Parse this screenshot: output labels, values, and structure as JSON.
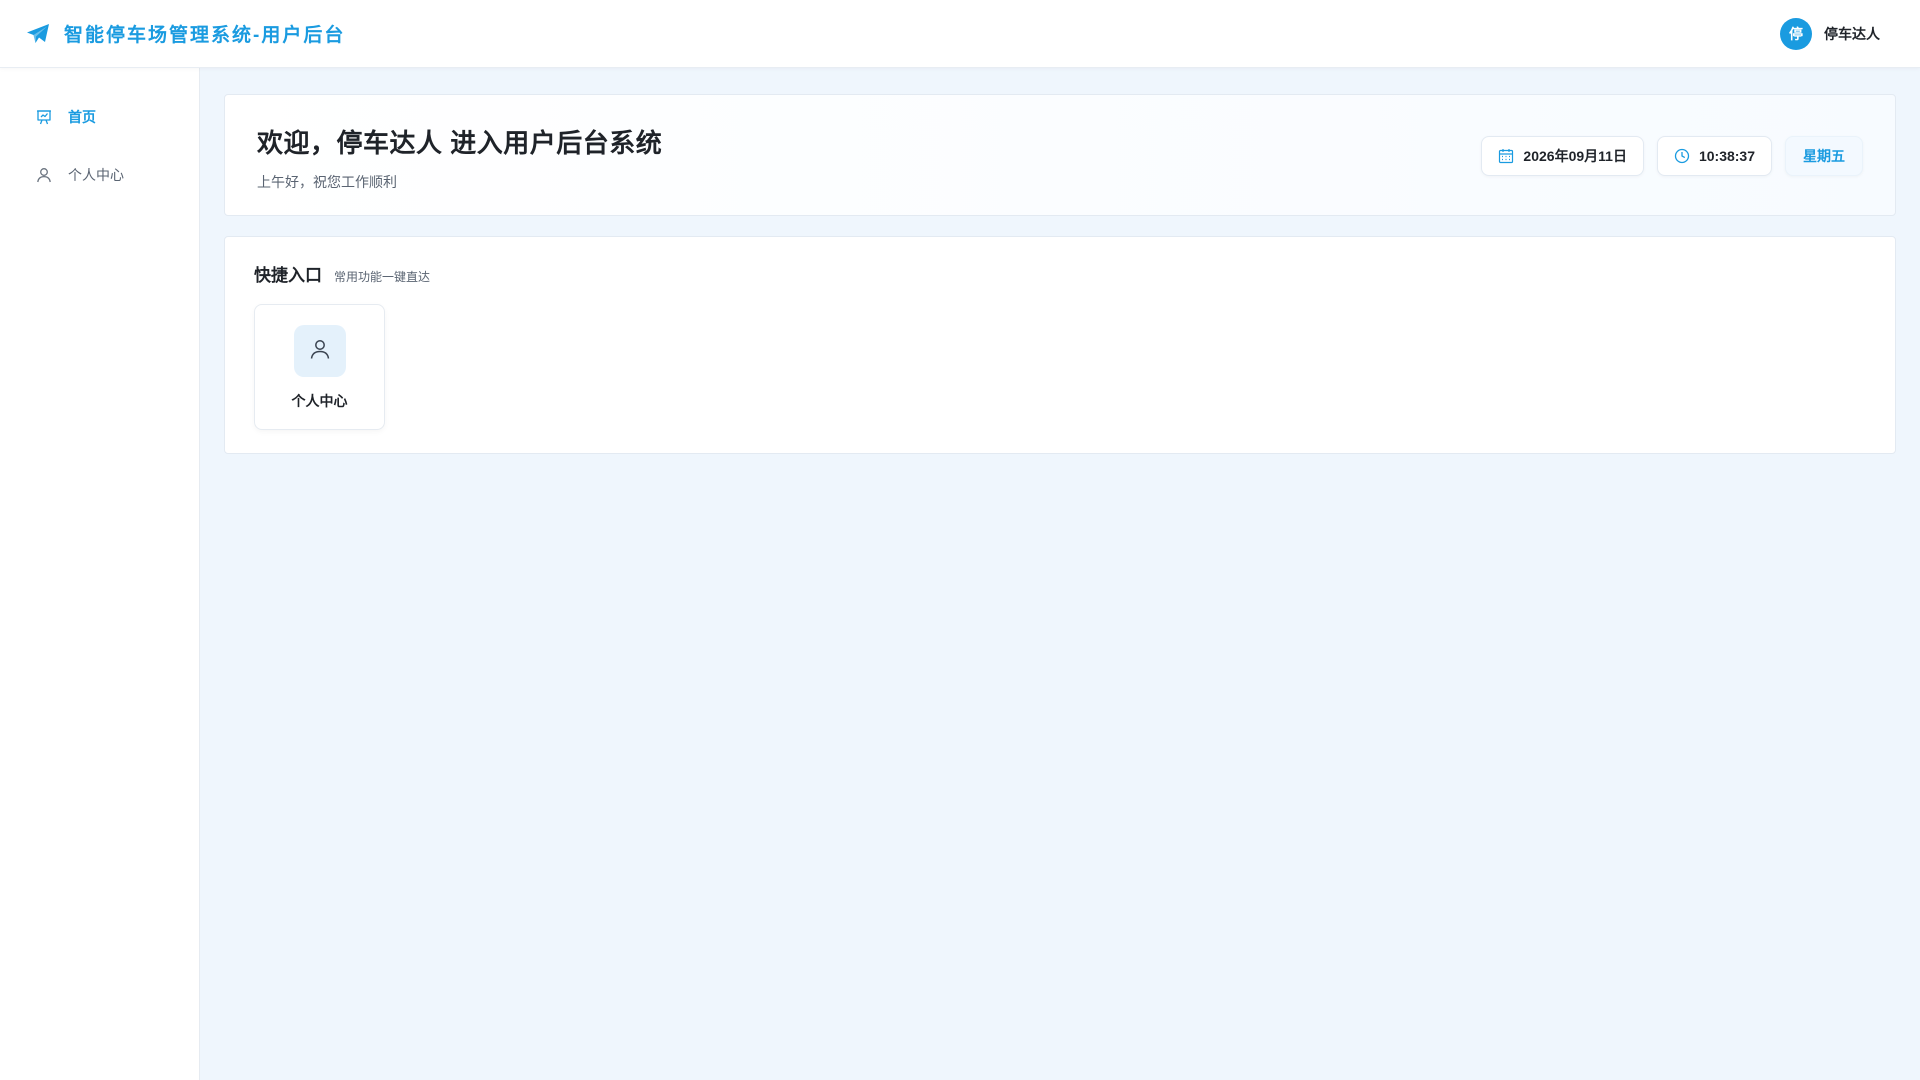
{
  "header": {
    "title": "智能停车场管理系统-用户后台",
    "brand_icon": "paper-plane-icon",
    "user": {
      "avatar_text": "停",
      "name": "停车达人"
    }
  },
  "sidebar": {
    "items": [
      {
        "label": "首页",
        "icon": "presentation-chart-icon",
        "active": true
      },
      {
        "label": "个人中心",
        "icon": "user-icon",
        "active": false
      }
    ]
  },
  "welcome": {
    "title": "欢迎，停车达人 进入用户后台系统",
    "subtitle": "上午好，祝您工作顺利",
    "date": "2026年09月11日",
    "time": "10:38:37",
    "weekday": "星期五"
  },
  "quick_access": {
    "title": "快捷入口",
    "subtitle": "常用功能一键直达",
    "items": [
      {
        "label": "个人中心",
        "icon": "user-icon"
      }
    ]
  },
  "colors": {
    "accent": "#1a9be0",
    "background": "#eff6fd",
    "icon_box": "#e4f1fb"
  }
}
